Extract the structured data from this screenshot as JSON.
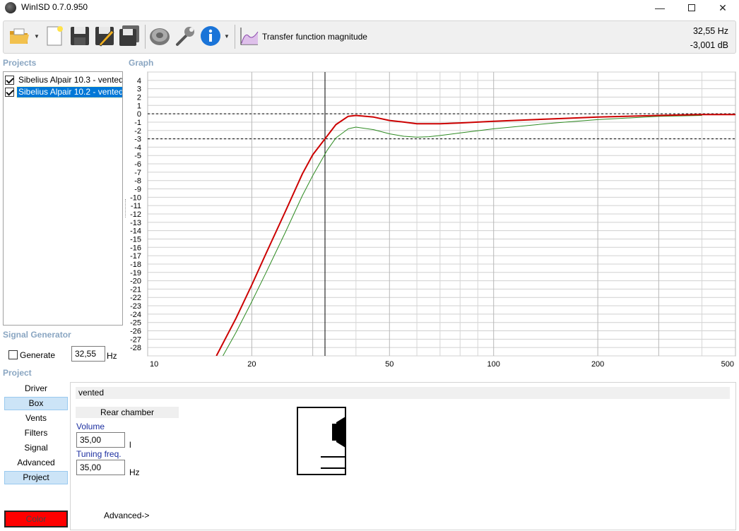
{
  "window": {
    "title": "WinISD 0.7.0.950"
  },
  "toolbar": {
    "view_label": "Transfer function magnitude",
    "readout_freq": "32,55 Hz",
    "readout_level": "-3,001 dB",
    "icons": [
      "open-folder-icon",
      "new-document-icon",
      "save-icon",
      "edit-save-icon",
      "save-all-icon",
      "speaker-driver-icon",
      "wrench-icon",
      "info-icon",
      "graph-icon"
    ]
  },
  "sections": {
    "projects": "Projects",
    "graph": "Graph",
    "signal_generator": "Signal Generator",
    "project": "Project"
  },
  "projects": [
    {
      "label": "Sibelius Alpair 10.3 - vented",
      "checked": true,
      "selected": false
    },
    {
      "label": "Sibelius Alpair 10.2 - vented",
      "checked": true,
      "selected": true
    }
  ],
  "signal_generator": {
    "generate_label": "Generate",
    "generate_checked": false,
    "frequency": "32,55",
    "unit": "Hz"
  },
  "project_nav": {
    "items": [
      "Driver",
      "Box",
      "Vents",
      "Filters",
      "Signal",
      "Advanced",
      "Project"
    ],
    "selected": [
      "Box",
      "Project"
    ],
    "color_label": "Color",
    "color_value": "#ff0000"
  },
  "box": {
    "type": "vented",
    "rear_chamber": "Rear chamber",
    "volume_label": "Volume",
    "volume_value": "35,00",
    "volume_unit": "l",
    "tuning_label": "Tuning freq.",
    "tuning_value": "35,00",
    "tuning_unit": "Hz",
    "advanced_link": "Advanced->"
  },
  "chart_data": {
    "type": "line",
    "x_scale": "log",
    "xlim": [
      10,
      500
    ],
    "ylim": [
      -29,
      5
    ],
    "x_tick_labels": [
      "10",
      "20",
      "50",
      "100",
      "200",
      "500"
    ],
    "y_tick_labels": [
      "4",
      "3",
      "2",
      "1",
      "0",
      "-1",
      "-2",
      "-3",
      "-4",
      "-5",
      "-6",
      "-7",
      "-8",
      "-9",
      "-10",
      "-11",
      "-12",
      "-13",
      "-14",
      "-15",
      "-16",
      "-17",
      "-18",
      "-19",
      "-20",
      "-21",
      "-22",
      "-23",
      "-24",
      "-25",
      "-26",
      "-27",
      "-28"
    ],
    "grid": true,
    "cursor_x": 32.55,
    "reference_lines_y": [
      0,
      -3
    ],
    "series": [
      {
        "color": "#cc0000",
        "x": [
          15.8,
          18,
          20,
          22,
          25,
          28,
          30,
          32.55,
          35,
          38,
          40,
          45,
          50,
          55,
          60,
          70,
          80,
          100,
          150,
          200,
          300,
          400,
          500
        ],
        "y": [
          -29,
          -24.5,
          -20.5,
          -16.7,
          -11.7,
          -7.2,
          -4.9,
          -3.0,
          -1.3,
          -0.3,
          -0.2,
          -0.4,
          -0.8,
          -1.0,
          -1.2,
          -1.2,
          -1.1,
          -0.9,
          -0.6,
          -0.4,
          -0.2,
          -0.1,
          -0.1
        ]
      },
      {
        "color": "#2e8b22",
        "x": [
          16.5,
          18,
          20,
          22,
          25,
          28,
          30,
          33,
          35,
          38,
          40,
          45,
          50,
          55,
          60,
          65,
          70,
          80,
          100,
          150,
          200,
          300,
          400
        ],
        "y": [
          -29,
          -26.2,
          -22.5,
          -19,
          -14.2,
          -9.8,
          -7.4,
          -4.4,
          -2.9,
          -1.8,
          -1.6,
          -1.9,
          -2.4,
          -2.7,
          -2.8,
          -2.75,
          -2.6,
          -2.3,
          -1.8,
          -1.1,
          -0.7,
          -0.3,
          -0.2
        ]
      }
    ]
  }
}
